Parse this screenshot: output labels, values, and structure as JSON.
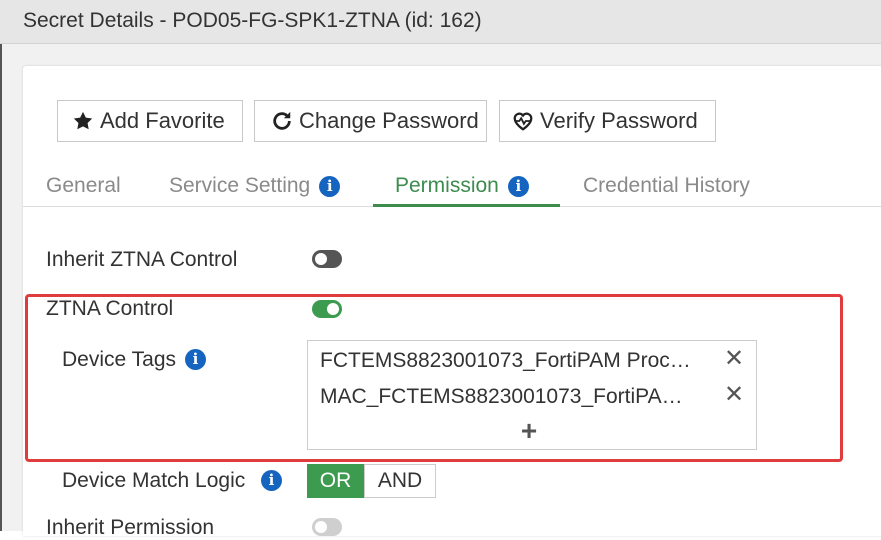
{
  "window": {
    "title": "Secret Details - POD05-FG-SPK1-ZTNA (id: 162)"
  },
  "toolbar": {
    "add_favorite": "Add Favorite",
    "change_password": "Change Password",
    "verify_password": "Verify Password"
  },
  "tabs": [
    {
      "label": "General",
      "active": false
    },
    {
      "label": "Service Setting",
      "active": false,
      "info": true
    },
    {
      "label": "Permission",
      "active": true,
      "info": true
    },
    {
      "label": "Credential History",
      "active": false
    }
  ],
  "permission": {
    "inherit_ztna_label": "Inherit ZTNA Control",
    "inherit_ztna_enabled": false,
    "ztna_control_label": "ZTNA Control",
    "ztna_control_enabled": true,
    "device_tags_label": "Device Tags",
    "device_tags": [
      "FCTEMS8823001073_FortiPAM Proc…",
      "MAC_FCTEMS8823001073_FortiPA…"
    ],
    "device_match_logic_label": "Device Match Logic",
    "match_logic_options": [
      "OR",
      "AND"
    ],
    "match_logic_selected": "OR",
    "inherit_permission_label": "Inherit Permission"
  },
  "colors": {
    "accent_green": "#3d9b50",
    "info_blue": "#1565c0",
    "highlight_red": "#e03c3c"
  }
}
